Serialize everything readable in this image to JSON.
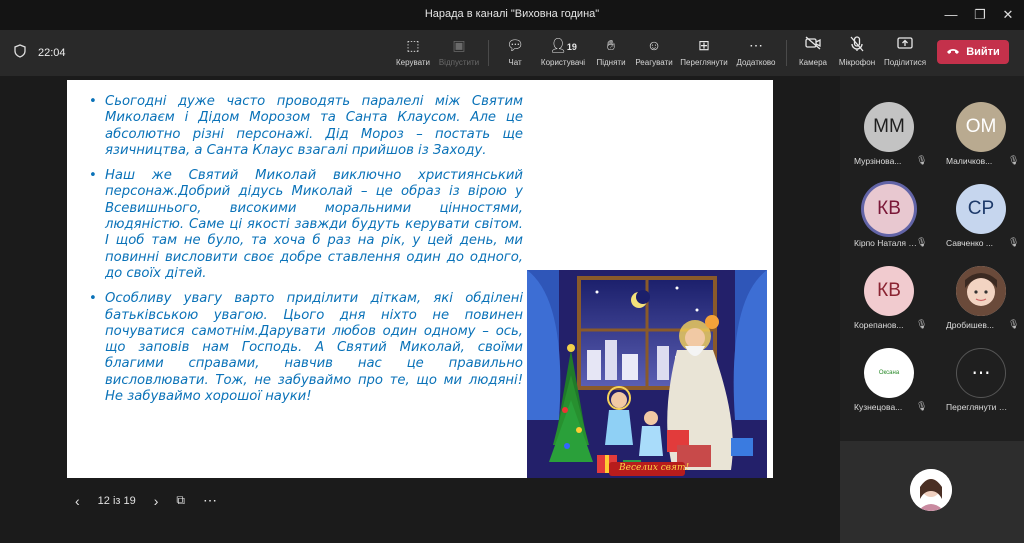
{
  "window": {
    "title": "Нарада в каналі \"Виховна година\""
  },
  "call": {
    "time": "22:04"
  },
  "toolbar": {
    "control": "Керувати",
    "release": "Відпустити",
    "chat": "Чат",
    "people": "Користувачі",
    "people_count": "19",
    "raise": "Підняти",
    "react": "Реагувати",
    "view": "Переглянути",
    "more": "Додатково",
    "camera": "Камера",
    "mic": "Мікрофон",
    "share": "Поділитися",
    "leave": "Вийти"
  },
  "slide": {
    "bullets": [
      "Сьогодні дуже часто проводять паралелі між Святим Миколаєм і Дідом Морозом та Санта Клаусом. Але це абсолютно різні персонажі. Дід Мороз – постать ще язичництва, а Санта Клаус взагалі прийшов із Заходу.",
      "Наш же Святий Миколай виключно християнський персонаж.Добрий дідусь Миколай – це образ із вірою у Всевишнього, високими моральними цінностями, людяністю. Саме ці якості завжди будуть керувати світом. І щоб там не було, та хоча б раз на рік, у цей день, ми повинні висловити своє добре ставлення один до одного, до своїх дітей.",
      "Особливу увагу варто приділити діткам, які обділені батьківською увагою. Цього дня ніхто не повинен почуватися самотнім.Дарувати любов один одному – ось, що заповів нам Господь. А Святий Миколай, своїми благими справами, навчив нас це правильно висловлювати. Тож, не забуваймо про те, що ми людяні! Не забуваймо хорошої науки!"
    ],
    "picture_caption": "Веселих свят!"
  },
  "slidenav": {
    "page": "12 із 19"
  },
  "participants": [
    {
      "initials": "ММ",
      "name": "Мурзінова...",
      "bg": "#c3c3c3",
      "fg": "#1f1f1f"
    },
    {
      "initials": "ОМ",
      "name": "Маличков...",
      "bg": "#b9aa90",
      "fg": "#ffffff"
    },
    {
      "initials": "КВ",
      "name": "Кірпо Наталя В...",
      "bg": "#e8c8d0",
      "fg": "#7a1838"
    },
    {
      "initials": "СР",
      "name": "Савченко ...",
      "bg": "#c6d6ee",
      "fg": "#1d3a6a"
    },
    {
      "initials": "КВ",
      "name": "Корепанов...",
      "bg": "#f1cbcf",
      "fg": "#8a2432"
    },
    {
      "initials": "",
      "name": "Дробишев...",
      "bg": "#ece2dc",
      "fg": "#333333"
    },
    {
      "initials": "",
      "name": "Кузнецова...",
      "bg": "#ffffff",
      "fg": "#2a8a2a",
      "logo_text": "Оксана"
    },
    {
      "initials": "⋯",
      "name": "Переглянути в...",
      "bg": "#1f1f1f",
      "fg": "#ffffff"
    }
  ],
  "colors": {
    "accent_leave": "#c4314b",
    "slide_text": "#0a72b8"
  }
}
